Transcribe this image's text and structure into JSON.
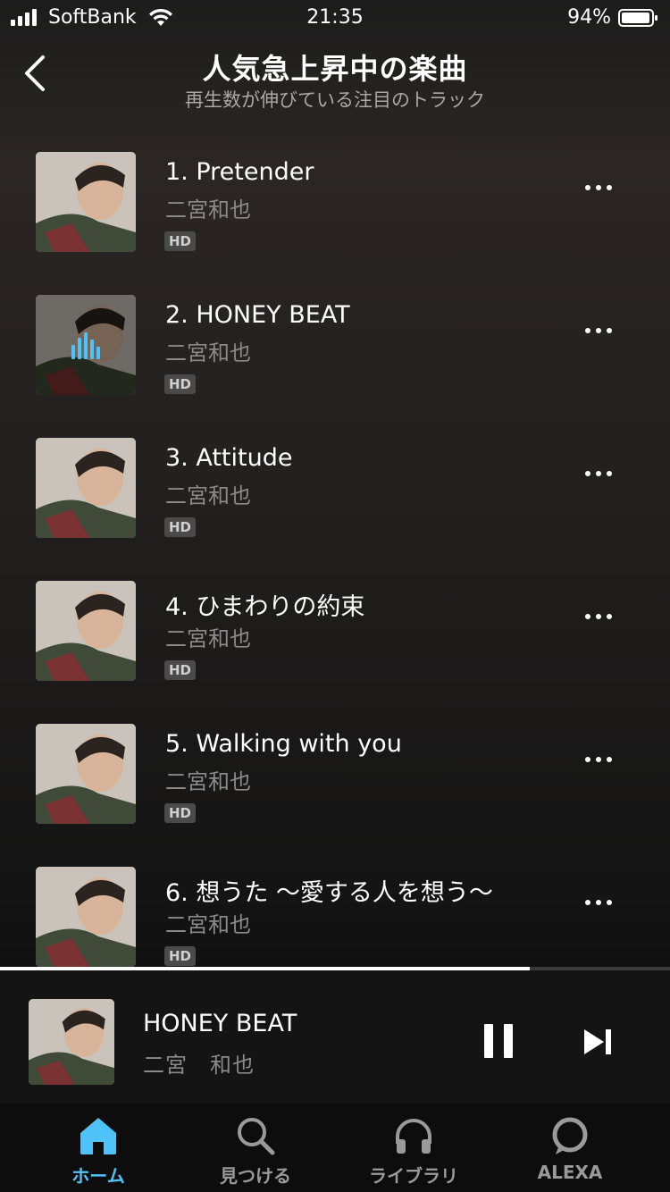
{
  "status_bar": {
    "carrier": "SoftBank",
    "time": "21:35",
    "battery_percent": "94%"
  },
  "header": {
    "title": "人気急上昇中の楽曲",
    "subtitle": "再生数が伸びている注目のトラック"
  },
  "tracks": [
    {
      "title": "1. Pretender",
      "artist": "二宮和也",
      "badge": "HD"
    },
    {
      "title": "2. HONEY BEAT",
      "artist": "二宮和也",
      "badge": "HD",
      "playing": true
    },
    {
      "title": "3. Attitude",
      "artist": "二宮和也",
      "badge": "HD"
    },
    {
      "title": "4. ひまわりの約束",
      "artist": "二宮和也",
      "badge": "HD"
    },
    {
      "title": "5. Walking with you",
      "artist": "二宮和也",
      "badge": "HD"
    },
    {
      "title": "6. 想うた 〜愛する人を想う〜",
      "artist": "二宮和也",
      "badge": "HD"
    }
  ],
  "now_playing": {
    "title": "HONEY BEAT",
    "artist": "二宮　和也",
    "progress": 0.79
  },
  "tabs": [
    {
      "label": "ホーム",
      "icon": "home-icon",
      "active": true
    },
    {
      "label": "見つける",
      "icon": "search-icon",
      "active": false
    },
    {
      "label": "ライブラリ",
      "icon": "headphones-icon",
      "active": false
    },
    {
      "label": "ALEXA",
      "icon": "alexa-icon",
      "active": false
    }
  ],
  "colors": {
    "accent": "#4fc3f7",
    "background": "#0d0d0d",
    "secondary_text": "#8a8a8a"
  }
}
